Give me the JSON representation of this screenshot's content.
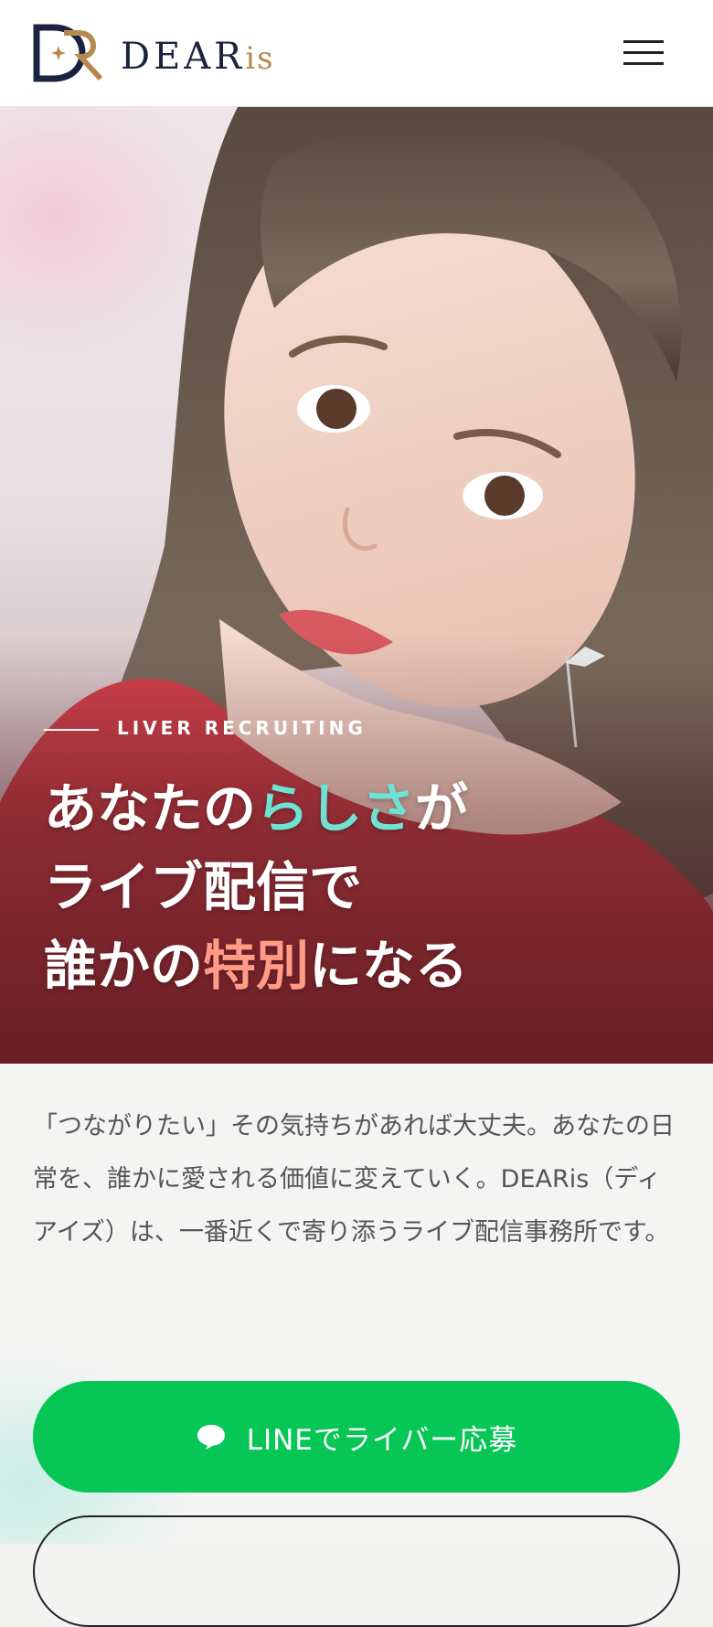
{
  "header": {
    "logo_text": "DEAR",
    "logo_suffix": "is"
  },
  "hero": {
    "eyebrow": "LIVER RECRUITING",
    "headline": {
      "line1_a": "あなたの",
      "line1_b": "らしさ",
      "line1_c": "が",
      "line2": "ライブ配信で",
      "line3_a": "誰かの",
      "line3_b": "特別",
      "line3_c": "になる"
    }
  },
  "content": {
    "intro": "「つながりたい」その気持ちがあれば大丈夫。あなたの日常を、誰かに愛される価値に変えていく。DEARis（ディアイズ）は、一番近くで寄り添うライブ配信事務所です。",
    "line_button_label": "LINEでライバー応募"
  },
  "colors": {
    "accent_teal": "#6ee3d4",
    "accent_coral": "#ff9b86",
    "line_green": "#06c755",
    "logo_navy": "#1a2440",
    "logo_gold": "#b68a4f"
  },
  "icons": {
    "menu": "hamburger-icon",
    "line": "chat-bubble-icon"
  }
}
